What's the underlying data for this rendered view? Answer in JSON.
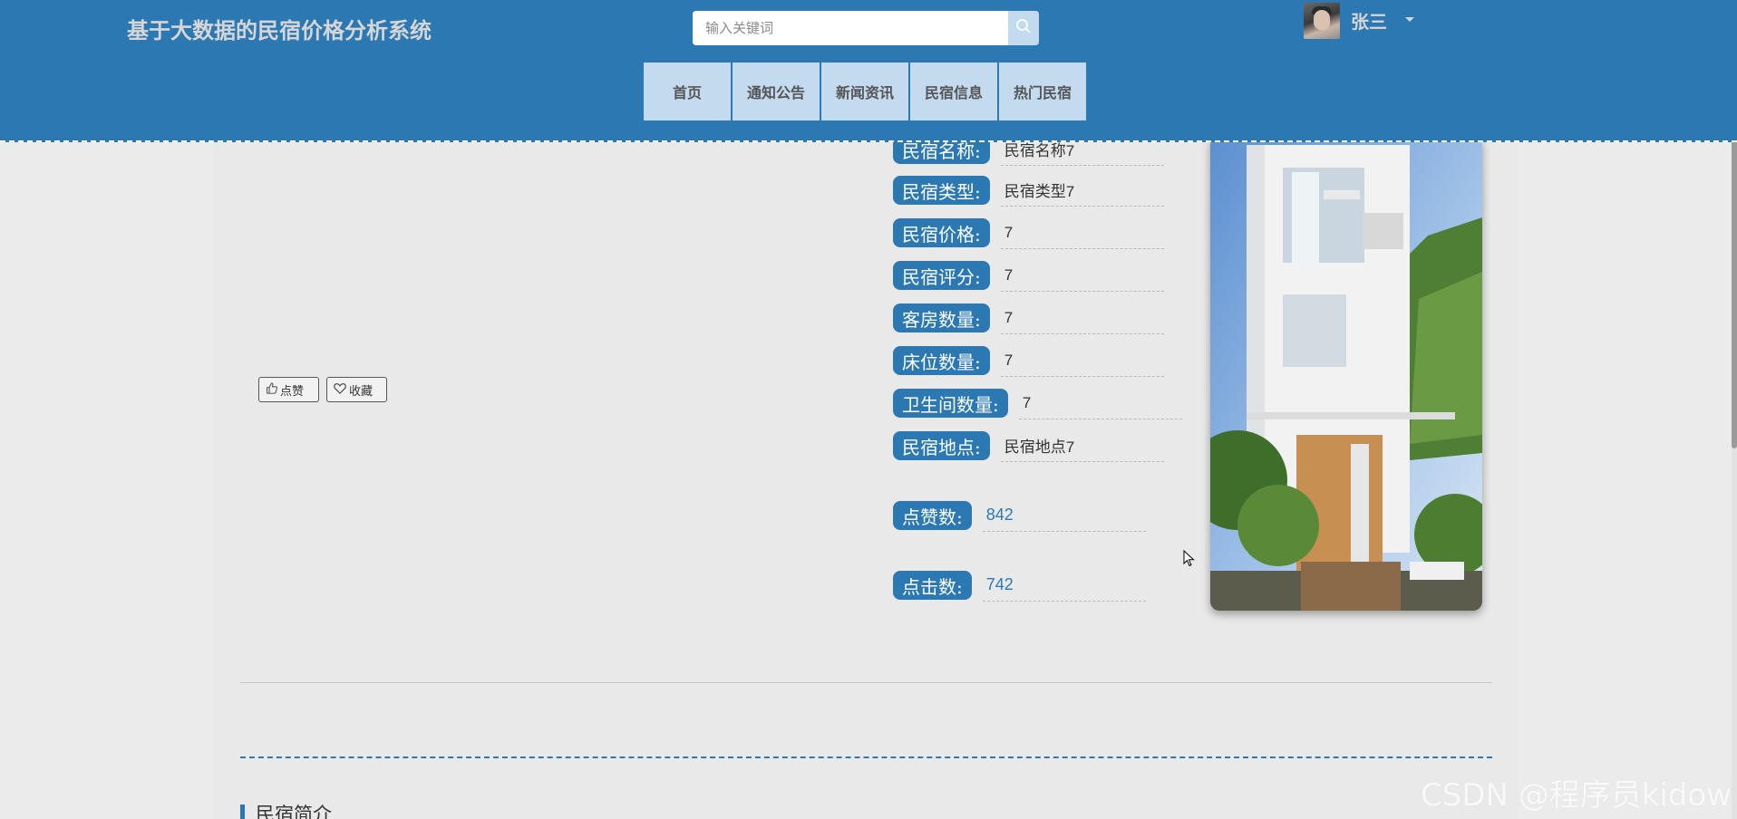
{
  "header": {
    "site_title": "基于大数据的民宿价格分析系统",
    "search_placeholder": "输入关键词",
    "username": "张三"
  },
  "nav": {
    "items": [
      "首页",
      "通知公告",
      "新闻资讯",
      "民宿信息",
      "热门民宿"
    ]
  },
  "actions": {
    "like_label": "点赞",
    "favorite_label": "收藏"
  },
  "details": {
    "fields": [
      {
        "label": "民宿名称:",
        "value": "民宿名称7"
      },
      {
        "label": "民宿类型:",
        "value": "民宿类型7"
      },
      {
        "label": "民宿价格:",
        "value": "7"
      },
      {
        "label": "民宿评分:",
        "value": "7"
      },
      {
        "label": "客房数量:",
        "value": "7"
      },
      {
        "label": "床位数量:",
        "value": "7"
      },
      {
        "label": "卫生间数量:",
        "value": "7"
      },
      {
        "label": "民宿地点:",
        "value": "民宿地点7"
      }
    ],
    "likes_label": "点赞数:",
    "likes_value": "842",
    "clicks_label": "点击数:",
    "clicks_value": "742"
  },
  "section": {
    "title": "民宿简介"
  },
  "watermark": "CSDN @程序员kidow",
  "colors": {
    "primary": "#2c78b3",
    "nav_bg": "#c3daef",
    "page_bg": "#ebebeb"
  }
}
